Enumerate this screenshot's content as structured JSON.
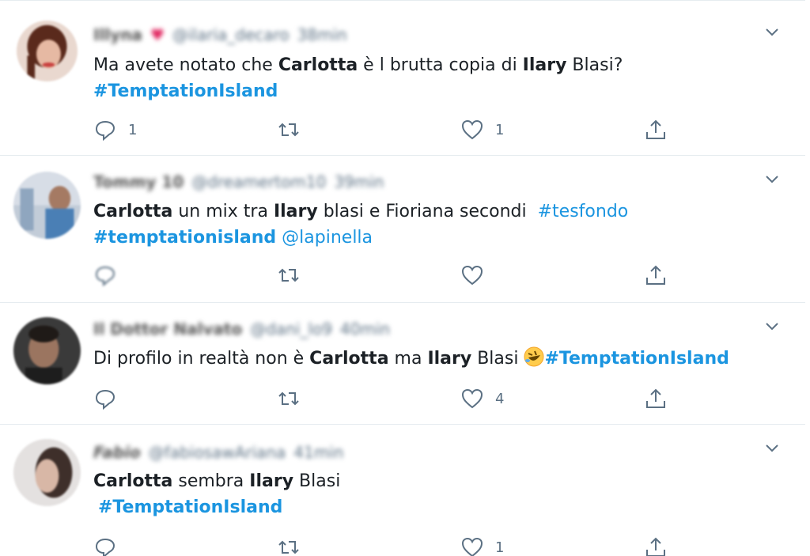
{
  "tweets": [
    {
      "author_name": "Illyna",
      "handle": "@ilaria_decaro",
      "time": "38min",
      "segments": [
        {
          "t": "Ma avete notato che ",
          "s": "normal"
        },
        {
          "t": "Carlotta",
          "s": "bold"
        },
        {
          "t": " è l brutta copia di ",
          "s": "normal"
        },
        {
          "t": "Ilary",
          "s": "bold"
        },
        {
          "t": " Blasi?",
          "s": "normal"
        }
      ],
      "line2": "#TemptationIsland",
      "reply_count": "1",
      "retweet_count": "",
      "like_count": "1"
    },
    {
      "author_name": "Tommy 10",
      "handle": "@dreamertom10",
      "time": "39min",
      "segments": [
        {
          "t": "Carlotta",
          "s": "bold"
        },
        {
          "t": " un mix tra ",
          "s": "normal"
        },
        {
          "t": "Ilary",
          "s": "bold"
        },
        {
          "t": " blasi e Fioriana secondi  ",
          "s": "normal"
        },
        {
          "t": "#tesfondo",
          "s": "tag"
        }
      ],
      "line2": "#temptationisland",
      "mention": "@lapinella",
      "reply_count": "",
      "retweet_count": "",
      "like_count": ""
    },
    {
      "author_name": "Il Dottor Nalvato",
      "handle": "@dani_lo9",
      "time": "40min",
      "segments": [
        {
          "t": "Di profilo in realtà non è ",
          "s": "normal"
        },
        {
          "t": "Carlotta",
          "s": "bold"
        },
        {
          "t": " ma ",
          "s": "normal"
        },
        {
          "t": "Ilary",
          "s": "bold"
        },
        {
          "t": " Blasi ",
          "s": "normal"
        }
      ],
      "hashtag": "#TemptationIsland",
      "emoji": "rofl-emoji",
      "reply_count": "",
      "retweet_count": "",
      "like_count": "4"
    },
    {
      "author_name": "Fabio",
      "handle": "@fabiosawAriana",
      "time": "41min",
      "segments": [
        {
          "t": "Carlotta",
          "s": "bold"
        },
        {
          "t": " sembra ",
          "s": "normal"
        },
        {
          "t": "Ilary",
          "s": "bold"
        },
        {
          "t": " Blasi",
          "s": "normal"
        }
      ],
      "line2": "#TemptationIsland",
      "reply_count": "",
      "retweet_count": "",
      "like_count": "1"
    }
  ],
  "colors": {
    "link": "#1b95e0",
    "icon": "#5b7083",
    "divider": "#e6ecf0",
    "text": "#1c2126"
  },
  "icons": [
    "reply-icon",
    "retweet-icon",
    "like-icon",
    "share-icon",
    "chevron-down-icon"
  ]
}
